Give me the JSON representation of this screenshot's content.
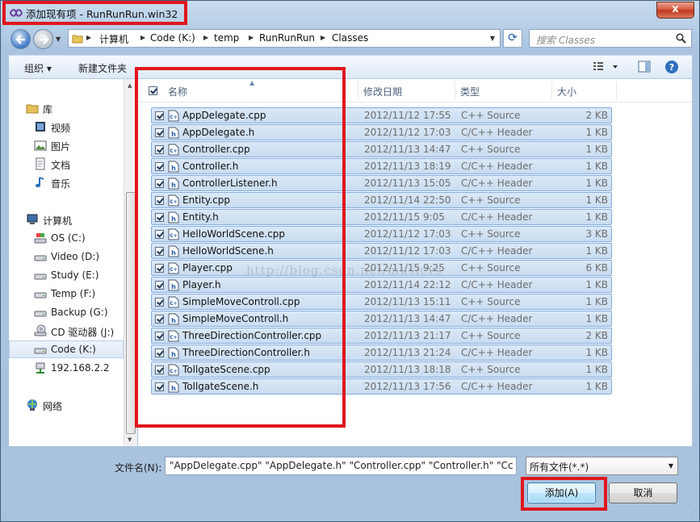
{
  "window": {
    "title": "添加现有项 - RunRunRun.win32",
    "close_label": "x"
  },
  "address": {
    "crumbs": [
      "计算机",
      "Code (K:)",
      "temp",
      "RunRunRun",
      "Classes"
    ],
    "search_placeholder": "搜索 Classes"
  },
  "toolbar": {
    "organize_label": "组织 ▾",
    "new_folder_label": "新建文件夹"
  },
  "nav": {
    "items": [
      {
        "label": "库",
        "icon": "library-icon"
      },
      {
        "label": "视频",
        "icon": "video-icon"
      },
      {
        "label": "图片",
        "icon": "pictures-icon"
      },
      {
        "label": "文档",
        "icon": "documents-icon"
      },
      {
        "label": "音乐",
        "icon": "music-icon"
      },
      {
        "label": "计算机",
        "icon": "computer-icon"
      },
      {
        "label": "OS (C:)",
        "icon": "drive-icon"
      },
      {
        "label": "Video (D:)",
        "icon": "drive-icon"
      },
      {
        "label": "Study (E:)",
        "icon": "drive-icon"
      },
      {
        "label": "Temp (F:)",
        "icon": "drive-icon"
      },
      {
        "label": "Backup (G:)",
        "icon": "drive-icon"
      },
      {
        "label": "CD 驱动器 (J:)",
        "icon": "cd-drive-icon"
      },
      {
        "label": "Code (K:)",
        "icon": "drive-icon"
      },
      {
        "label": "192.168.2.2",
        "icon": "network-drive-icon"
      },
      {
        "label": "网络",
        "icon": "network-icon"
      }
    ]
  },
  "columns": {
    "name": "名称",
    "modified": "修改日期",
    "type": "类型",
    "size": "大小"
  },
  "files": [
    {
      "name": "AppDelegate.cpp",
      "date": "2012/11/12 17:55",
      "type": "C++ Source",
      "size": "2 KB",
      "kind": "cpp"
    },
    {
      "name": "AppDelegate.h",
      "date": "2012/11/12 17:03",
      "type": "C/C++ Header",
      "size": "1 KB",
      "kind": "h"
    },
    {
      "name": "Controller.cpp",
      "date": "2012/11/13 14:47",
      "type": "C++ Source",
      "size": "1 KB",
      "kind": "cpp"
    },
    {
      "name": "Controller.h",
      "date": "2012/11/13 18:19",
      "type": "C/C++ Header",
      "size": "1 KB",
      "kind": "h"
    },
    {
      "name": "ControllerListener.h",
      "date": "2012/11/13 15:05",
      "type": "C/C++ Header",
      "size": "1 KB",
      "kind": "h"
    },
    {
      "name": "Entity.cpp",
      "date": "2012/11/14 22:50",
      "type": "C++ Source",
      "size": "1 KB",
      "kind": "cpp"
    },
    {
      "name": "Entity.h",
      "date": "2012/11/15 9:05",
      "type": "C/C++ Header",
      "size": "1 KB",
      "kind": "h"
    },
    {
      "name": "HelloWorldScene.cpp",
      "date": "2012/11/12 17:03",
      "type": "C++ Source",
      "size": "3 KB",
      "kind": "cpp"
    },
    {
      "name": "HelloWorldScene.h",
      "date": "2012/11/12 17:03",
      "type": "C/C++ Header",
      "size": "1 KB",
      "kind": "h"
    },
    {
      "name": "Player.cpp",
      "date": "2012/11/15 9:25",
      "type": "C++ Source",
      "size": "6 KB",
      "kind": "cpp"
    },
    {
      "name": "Player.h",
      "date": "2012/11/14 22:12",
      "type": "C/C++ Header",
      "size": "1 KB",
      "kind": "h"
    },
    {
      "name": "SimpleMoveControll.cpp",
      "date": "2012/11/13 15:11",
      "type": "C++ Source",
      "size": "1 KB",
      "kind": "cpp"
    },
    {
      "name": "SimpleMoveControll.h",
      "date": "2012/11/13 14:47",
      "type": "C/C++ Header",
      "size": "1 KB",
      "kind": "h"
    },
    {
      "name": "ThreeDirectionController.cpp",
      "date": "2012/11/13 21:17",
      "type": "C++ Source",
      "size": "2 KB",
      "kind": "cpp"
    },
    {
      "name": "ThreeDirectionController.h",
      "date": "2012/11/13 21:24",
      "type": "C/C++ Header",
      "size": "1 KB",
      "kind": "h"
    },
    {
      "name": "TollgateScene.cpp",
      "date": "2012/11/13 18:18",
      "type": "C++ Source",
      "size": "1 KB",
      "kind": "cpp"
    },
    {
      "name": "TollgateScene.h",
      "date": "2012/11/13 17:56",
      "type": "C/C++ Header",
      "size": "1 KB",
      "kind": "h"
    }
  ],
  "watermark": "http://blog.csdn.net/musicvs",
  "bottom": {
    "filename_label": "文件名(N):",
    "filename_value": "\"AppDelegate.cpp\" \"AppDelegate.h\" \"Controller.cpp\" \"Controller.h\" \"Cc",
    "filter_value": "所有文件(*.*)",
    "add_label": "添加(A)",
    "cancel_label": "取消"
  },
  "colors": {
    "highlight_box": "#e0161d",
    "selection": "#c9dcf1"
  }
}
